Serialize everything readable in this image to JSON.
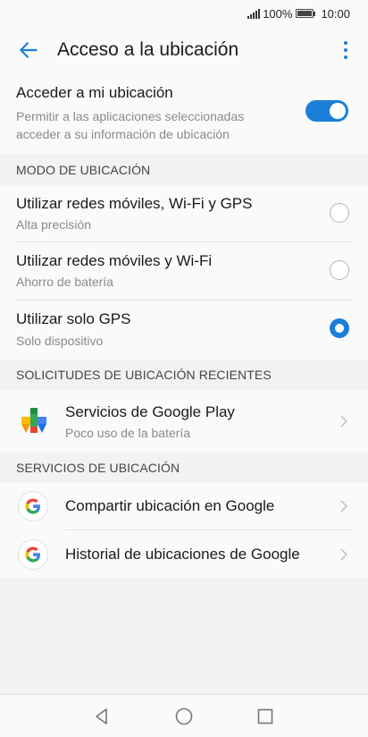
{
  "status_bar": {
    "battery_percent": "100%",
    "time": "10:00"
  },
  "app_bar": {
    "title": "Acceso a la ubicación",
    "back_icon": "arrow-left-icon",
    "menu_icon": "more-vert-icon"
  },
  "location_access": {
    "title": "Acceder a mi ubicación",
    "description": "Permitir a las aplicaciones seleccionadas acceder a su información de ubicación",
    "enabled": true
  },
  "location_mode": {
    "header": "MODO DE UBICACIÓN",
    "options": [
      {
        "title": "Utilizar redes móviles, Wi-Fi y GPS",
        "subtitle": "Alta precisión",
        "selected": false
      },
      {
        "title": "Utilizar redes móviles y Wi-Fi",
        "subtitle": "Ahorro de batería",
        "selected": false
      },
      {
        "title": "Utilizar solo GPS",
        "subtitle": "Solo dispositivo",
        "selected": true
      }
    ]
  },
  "recent_requests": {
    "header": "SOLICITUDES DE UBICACIÓN RECIENTES",
    "items": [
      {
        "title": "Servicios de Google Play",
        "subtitle": "Poco uso de la batería",
        "icon": "google-play-services-icon"
      }
    ]
  },
  "location_services": {
    "header": "SERVICIOS DE UBICACIÓN",
    "items": [
      {
        "title": "Compartir ubicación en Google",
        "icon": "google-g-icon"
      },
      {
        "title": "Historial de ubicaciones de Google",
        "icon": "google-g-icon"
      }
    ]
  },
  "colors": {
    "accent": "#1a7fd9",
    "background": "#f2f2f2",
    "card": "#fafafa",
    "subtitle": "#8a8a8a"
  },
  "nav_bar": {
    "back_icon": "triangle-back-icon",
    "home_icon": "circle-home-icon",
    "recents_icon": "square-recents-icon"
  }
}
